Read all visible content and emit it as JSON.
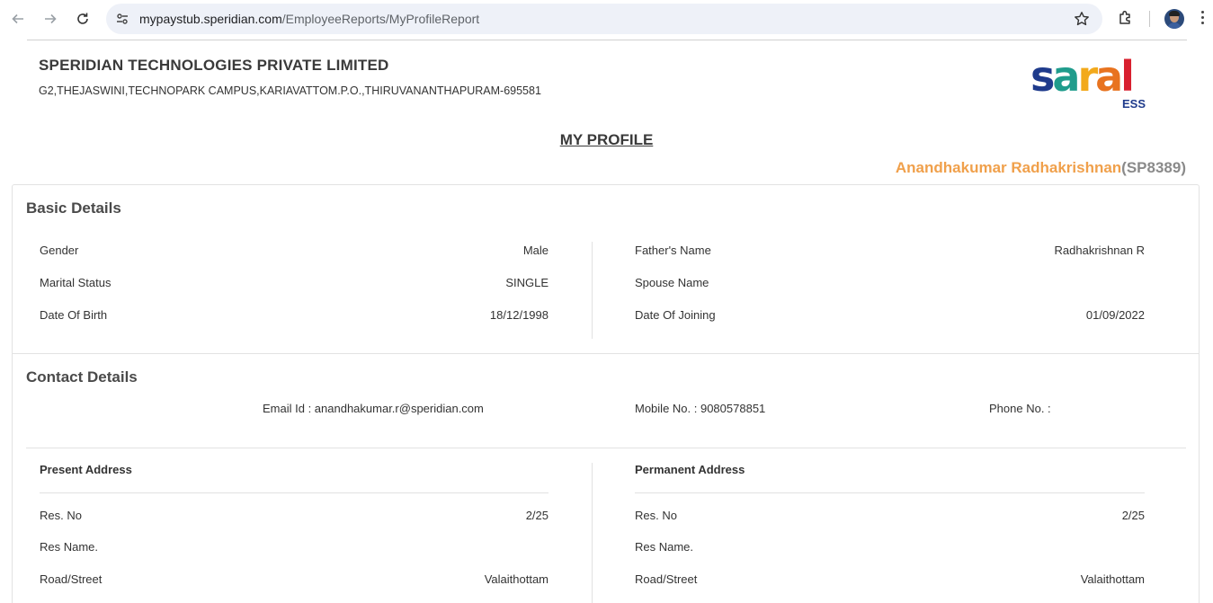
{
  "browser": {
    "url_host": "mypaystub.speridian.com",
    "url_path": "/EmployeeReports/MyProfileReport"
  },
  "header": {
    "company": "SPERIDIAN TECHNOLOGIES PRIVATE LIMITED",
    "address": "G2,THEJASWINI,TECHNOPARK CAMPUS,KARIAVATTOM.P.O.,THIRUVANANTHAPURAM-695581",
    "logo_text": "saral",
    "logo_sub": "ESS"
  },
  "page_title": "MY PROFILE",
  "employee": {
    "name": "Anandhakumar Radhakrishnan",
    "code": "(SP8389)"
  },
  "basic_details": {
    "title": "Basic Details",
    "left": [
      {
        "label": "Gender",
        "value": "Male"
      },
      {
        "label": "Marital Status",
        "value": "SINGLE"
      },
      {
        "label": "Date Of Birth",
        "value": "18/12/1998"
      }
    ],
    "right": [
      {
        "label": "Father's Name",
        "value": "Radhakrishnan R"
      },
      {
        "label": "Spouse Name",
        "value": ""
      },
      {
        "label": "Date Of Joining",
        "value": "01/09/2022"
      }
    ]
  },
  "contact_details": {
    "title": "Contact Details",
    "email": "Email Id : anandhakumar.r@speridian.com",
    "mobile": "Mobile No. : 9080578851",
    "phone": "Phone No. :"
  },
  "present_address": {
    "title": "Present Address",
    "rows": [
      {
        "label": "Res. No",
        "value": "2/25"
      },
      {
        "label": "Res Name.",
        "value": ""
      },
      {
        "label": "Road/Street",
        "value": "Valaithottam"
      }
    ]
  },
  "permanent_address": {
    "title": "Permanent Address",
    "rows": [
      {
        "label": "Res. No",
        "value": "2/25"
      },
      {
        "label": "Res Name.",
        "value": ""
      },
      {
        "label": "Road/Street",
        "value": "Valaithottam"
      }
    ]
  },
  "colors": {
    "accent_orange": "#f0a04b",
    "code_gray": "#8a8a8a"
  }
}
